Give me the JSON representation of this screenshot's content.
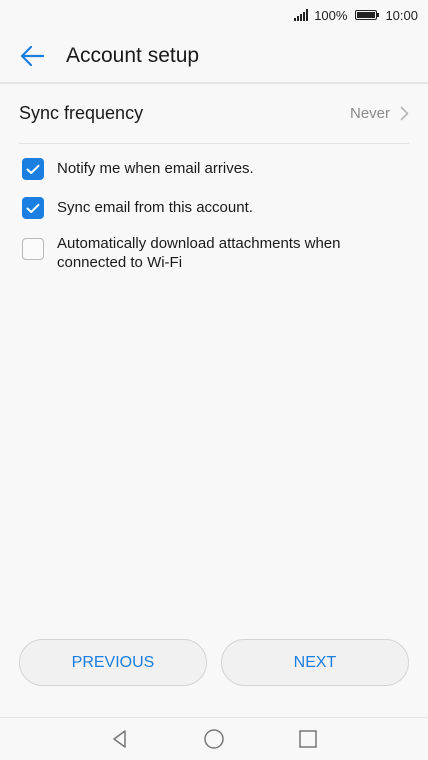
{
  "status_bar": {
    "battery": "100%",
    "time": "10:00",
    "icons": [
      "signal-icon",
      "battery-icon"
    ]
  },
  "header": {
    "title": "Account setup",
    "back_icon": "arrow-left-icon"
  },
  "sync_frequency": {
    "label": "Sync frequency",
    "value": "Never"
  },
  "options": [
    {
      "label": "Notify me when email arrives.",
      "checked": true
    },
    {
      "label": "Sync email from this account.",
      "checked": true
    },
    {
      "label": "Automatically download attachments when connected to Wi-Fi",
      "checked": false
    }
  ],
  "buttons": {
    "previous": "PREVIOUS",
    "next": "NEXT"
  },
  "nav": {
    "icons": [
      "back-triangle-icon",
      "home-circle-icon",
      "recents-square-icon"
    ]
  },
  "colors": {
    "accent": "#1a7fe0",
    "background": "#f8f8f8"
  }
}
